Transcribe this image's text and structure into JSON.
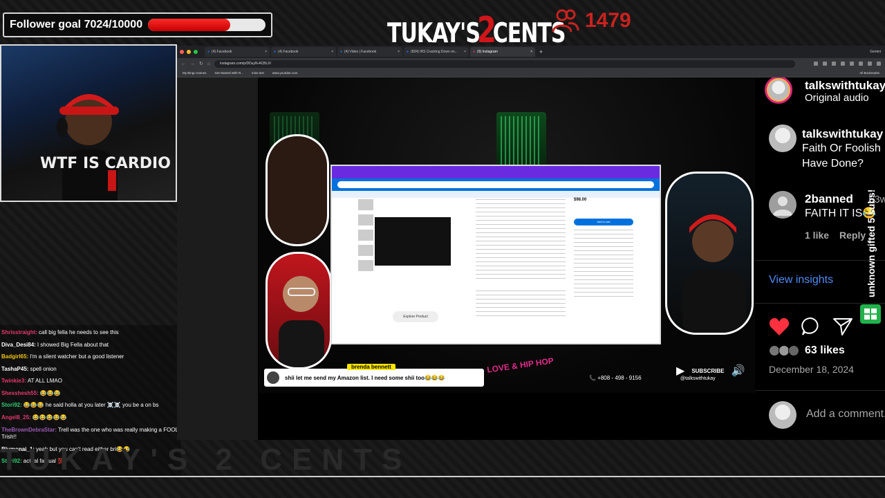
{
  "overlay": {
    "follower_goal": "Follower goal 7024/10000",
    "goal_progress": 0.7024,
    "logo": {
      "left": "TUKAY'S",
      "number": "2",
      "right": "CENTS"
    },
    "viewers": "1479",
    "accent": "#c8221f"
  },
  "webcam": {
    "shirt_text": "WTF IS CARDIO"
  },
  "chat": [
    {
      "user": "Shrisstraight:",
      "msg": "call big fella he needs to see this",
      "color": "#e4386d"
    },
    {
      "user": "Diva_Desi84:",
      "msg": "I showed Big Fella about that",
      "color": "#ffffff"
    },
    {
      "user": "Badgirl65:",
      "msg": "I'm a silent watcher but a good listener",
      "color": "#f1c40f"
    },
    {
      "user": "TashaP45:",
      "msg": "spell onion",
      "color": "#ffffff"
    },
    {
      "user": "Twinkie3:",
      "msg": "AT ALL LMAO",
      "color": "#e4386d"
    },
    {
      "user": "Shesshesh55:",
      "msg": "😂😂😂",
      "color": "#e4386d"
    },
    {
      "user": "Stori92:",
      "msg": "😂😂😂 he said holla at you later ☠️☠️ you be a on bs",
      "color": "#2ecc71"
    },
    {
      "user": "Angel8_25:",
      "msg": "😂😂😂😂😂",
      "color": "#e4386d"
    },
    {
      "user": "TheBrownDebraStar:",
      "msg": "Trell was the one who was really making a FOOL Trish!!",
      "color": "#9b59b6"
    },
    {
      "user": "Blumonai_1:",
      "msg": "yeah but you can't read either bri😂😂",
      "color": "#ffffff"
    },
    {
      "user": "Stori92:",
      "msg": "actual factual 💯",
      "color": "#2ecc71"
    }
  ],
  "browser": {
    "tabs": [
      {
        "label": "(4) Facebook",
        "active": false
      },
      {
        "label": "(4) Facebook",
        "active": false
      },
      {
        "label": "(4) Video | Facebook",
        "active": false
      },
      {
        "label": "(834) IRS Cracking Down on...",
        "active": false
      },
      {
        "label": "(9) Instagram",
        "active": true
      }
    ],
    "new_tab": "+",
    "gemini": "Gemini",
    "url": "instagram.com/p/DDuyN-ACBLX/",
    "bookmarks": [
      "My Bingo Games",
      "Get Started With R...",
      "miss text",
      "www.youtube.com"
    ],
    "all_bookmarks": "All Bookmarks"
  },
  "reel": {
    "walmart": {
      "price": "$98.00",
      "add_to_cart": "Add to cart",
      "explore": "Explore Product"
    },
    "caption_name": "brenda bennett",
    "caption_text": "shii let me send my Amazon list. I need some shii too😂😂😂",
    "show_logo": "LOVE & HIP HOP",
    "phone": "+808 - 498 - 9156",
    "subscribe": "SUBSCRIBE",
    "handle": "@talkswithtukay"
  },
  "comments": {
    "author": "talkswithtukay",
    "audio": "Original audio",
    "post_user": "talkswithtukay",
    "post_text": [
      "Faith Or Foolish",
      "Have Done?"
    ],
    "commenter": "2banned",
    "comment_age": "53w",
    "comment_text": "FAITH IT IS😂",
    "comment_likes": "1 like",
    "reply": "Reply",
    "view_insights": "View insights",
    "likes": "63 likes",
    "date": "December 18, 2024",
    "add_comment": "Add a comment..."
  },
  "side_vertical": "unknown gifted 5 subs!",
  "bottom_text": "TUKAY'S 2 CENTS"
}
